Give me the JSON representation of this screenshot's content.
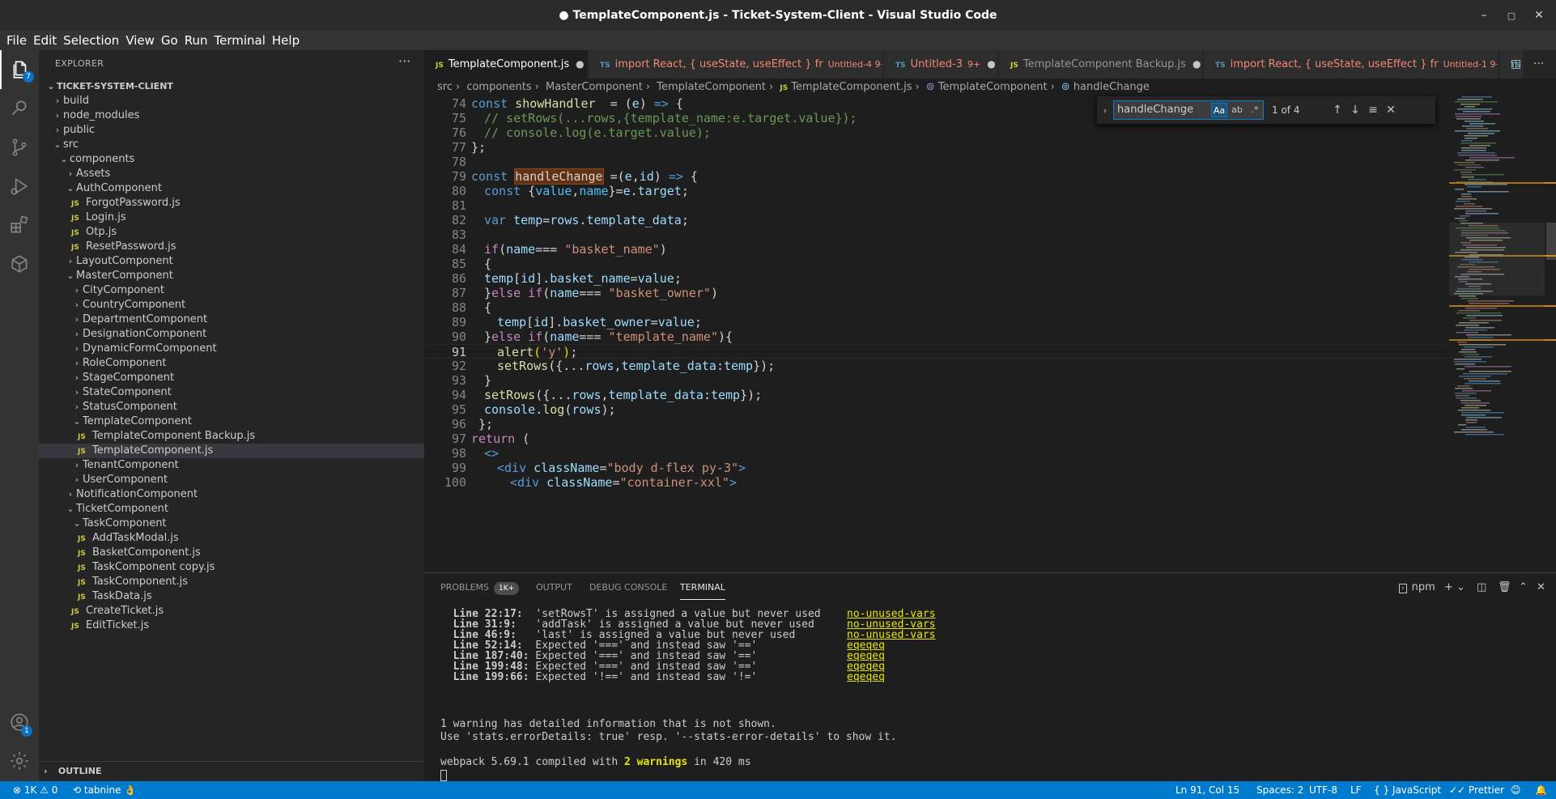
{
  "window": {
    "title": "● TemplateComponent.js - Ticket-System-Client - Visual Studio Code",
    "min_glyph": "–",
    "max_glyph": "▢",
    "close_glyph": "✕"
  },
  "menu": [
    "File",
    "Edit",
    "Selection",
    "View",
    "Go",
    "Run",
    "Terminal",
    "Help"
  ],
  "activity_bar": {
    "explorer_badge": "7",
    "accounts_badge": "1",
    "icons": [
      "files-icon",
      "search-icon",
      "source-control-icon",
      "run-debug-icon",
      "extensions-icon",
      "remote-explorer-icon",
      "accounts-icon",
      "settings-gear-icon"
    ]
  },
  "sidebar": {
    "title": "EXPLORER",
    "more": "···",
    "tree": [
      {
        "label": "TICKET-SYSTEM-CLIENT",
        "depth": 0,
        "kind": "root"
      },
      {
        "label": "build",
        "depth": 1,
        "kind": "folder-closed"
      },
      {
        "label": "node_modules",
        "depth": 1,
        "kind": "folder-closed"
      },
      {
        "label": "public",
        "depth": 1,
        "kind": "folder-closed"
      },
      {
        "label": "src",
        "depth": 1,
        "kind": "folder-open"
      },
      {
        "label": "components",
        "depth": 2,
        "kind": "folder-open"
      },
      {
        "label": "Assets",
        "depth": 3,
        "kind": "folder-closed"
      },
      {
        "label": "AuthComponent",
        "depth": 3,
        "kind": "folder-open"
      },
      {
        "label": "ForgotPassword.js",
        "depth": 4,
        "kind": "file"
      },
      {
        "label": "Login.js",
        "depth": 4,
        "kind": "file"
      },
      {
        "label": "Otp.js",
        "depth": 4,
        "kind": "file"
      },
      {
        "label": "ResetPassword.js",
        "depth": 4,
        "kind": "file"
      },
      {
        "label": "LayoutComponent",
        "depth": 3,
        "kind": "folder-closed"
      },
      {
        "label": "MasterComponent",
        "depth": 3,
        "kind": "folder-open"
      },
      {
        "label": "CityComponent",
        "depth": 4,
        "kind": "folder-closed"
      },
      {
        "label": "CountryComponent",
        "depth": 4,
        "kind": "folder-closed"
      },
      {
        "label": "DepartmentComponent",
        "depth": 4,
        "kind": "folder-closed"
      },
      {
        "label": "DesignationComponent",
        "depth": 4,
        "kind": "folder-closed"
      },
      {
        "label": "DynamicFormComponent",
        "depth": 4,
        "kind": "folder-closed"
      },
      {
        "label": "RoleComponent",
        "depth": 4,
        "kind": "folder-closed"
      },
      {
        "label": "StageComponent",
        "depth": 4,
        "kind": "folder-closed"
      },
      {
        "label": "StateComponent",
        "depth": 4,
        "kind": "folder-closed"
      },
      {
        "label": "StatusComponent",
        "depth": 4,
        "kind": "folder-closed"
      },
      {
        "label": "TemplateComponent",
        "depth": 4,
        "kind": "folder-open"
      },
      {
        "label": "TemplateComponent Backup.js",
        "depth": 5,
        "kind": "file"
      },
      {
        "label": "TemplateComponent.js",
        "depth": 5,
        "kind": "file",
        "selected": true
      },
      {
        "label": "TenantComponent",
        "depth": 4,
        "kind": "folder-closed"
      },
      {
        "label": "UserComponent",
        "depth": 4,
        "kind": "folder-closed"
      },
      {
        "label": "NotificationComponent",
        "depth": 3,
        "kind": "folder-closed"
      },
      {
        "label": "TicketComponent",
        "depth": 3,
        "kind": "folder-open"
      },
      {
        "label": "TaskComponent",
        "depth": 4,
        "kind": "folder-open"
      },
      {
        "label": "AddTaskModal.js",
        "depth": 5,
        "kind": "file"
      },
      {
        "label": "BasketComponent.js",
        "depth": 5,
        "kind": "file"
      },
      {
        "label": "TaskComponent copy.js",
        "depth": 5,
        "kind": "file"
      },
      {
        "label": "TaskComponent.js",
        "depth": 5,
        "kind": "file"
      },
      {
        "label": "TaskData.js",
        "depth": 5,
        "kind": "file"
      },
      {
        "label": "CreateTicket.js",
        "depth": 4,
        "kind": "file"
      },
      {
        "label": "EditTicket.js",
        "depth": 4,
        "kind": "file"
      }
    ],
    "outline_label": "OUTLINE"
  },
  "tabs": [
    {
      "icon": "JS",
      "label": "TemplateComponent.js",
      "active": true,
      "modified": true,
      "error": false,
      "sub": ""
    },
    {
      "icon": "TS",
      "label": "import React, { useState, useEffect } fr",
      "active": false,
      "modified": true,
      "error": true,
      "sub": "Untitled-4  9+"
    },
    {
      "icon": "TS",
      "label": "Untitled-3",
      "active": false,
      "modified": true,
      "error": true,
      "sub": "9+"
    },
    {
      "icon": "JS",
      "label": "TemplateComponent Backup.js",
      "active": false,
      "modified": true,
      "error": false,
      "sub": ""
    },
    {
      "icon": "TS",
      "label": "import React, { useState, useEffect } fr",
      "active": false,
      "modified": true,
      "error": true,
      "sub": "Untitled-1  9+"
    },
    {
      "icon": "TS",
      "label": "",
      "active": false,
      "modified": false,
      "error": false,
      "sub": ""
    }
  ],
  "breadcrumb": [
    "src",
    "components",
    "MasterComponent",
    "TemplateComponent",
    "TemplateComponent.js",
    "TemplateComponent",
    "handleChange"
  ],
  "editor": {
    "current_line": 91,
    "lines": [
      {
        "n": 74,
        "indent": 0,
        "tokens": [
          [
            "kw",
            "const "
          ],
          [
            "fn",
            "showHandler"
          ],
          [
            "",
            "  = ("
          ],
          [
            "var",
            "e"
          ],
          [
            "",
            ") "
          ],
          [
            "kw",
            "=>"
          ],
          [
            "",
            " {"
          ]
        ]
      },
      {
        "n": 75,
        "indent": 1,
        "tokens": [
          [
            "com",
            "// setRows(...rows,{template_name:e.target.value});"
          ]
        ]
      },
      {
        "n": 76,
        "indent": 1,
        "tokens": [
          [
            "com",
            "// console.log(e.target.value);"
          ]
        ]
      },
      {
        "n": 77,
        "indent": 0,
        "tokens": [
          [
            "",
            "};"
          ]
        ]
      },
      {
        "n": 78,
        "indent": 0,
        "tokens": []
      },
      {
        "n": 79,
        "indent": 0,
        "tokens": [
          [
            "kw",
            "const "
          ],
          [
            "hl",
            "handleChange"
          ],
          [
            "",
            " =("
          ],
          [
            "var",
            "e"
          ],
          [
            "",
            ","
          ],
          [
            "var",
            "id"
          ],
          [
            "",
            ") "
          ],
          [
            "kw",
            "=>"
          ],
          [
            "",
            " {"
          ]
        ]
      },
      {
        "n": 80,
        "indent": 1,
        "tokens": [
          [
            "kw",
            "const "
          ],
          [
            "",
            "{"
          ],
          [
            "cst",
            "value"
          ],
          [
            "",
            ","
          ],
          [
            "cst",
            "name"
          ],
          [
            "",
            "}="
          ],
          [
            "var",
            "e"
          ],
          [
            "",
            "."
          ],
          [
            "var",
            "target"
          ],
          [
            "",
            ";"
          ]
        ]
      },
      {
        "n": 81,
        "indent": 0,
        "tokens": []
      },
      {
        "n": 82,
        "indent": 1,
        "tokens": [
          [
            "kw",
            "var "
          ],
          [
            "var",
            "temp"
          ],
          [
            "",
            "="
          ],
          [
            "var",
            "rows"
          ],
          [
            "",
            "."
          ],
          [
            "var",
            "template_data"
          ],
          [
            "",
            ";"
          ]
        ]
      },
      {
        "n": 83,
        "indent": 0,
        "tokens": []
      },
      {
        "n": 84,
        "indent": 1,
        "tokens": [
          [
            "ctl",
            "if"
          ],
          [
            "",
            "("
          ],
          [
            "var",
            "name"
          ],
          [
            "",
            "=== "
          ],
          [
            "str",
            "\"basket_name\""
          ],
          [
            "",
            ")"
          ]
        ]
      },
      {
        "n": 85,
        "indent": 1,
        "tokens": [
          [
            "",
            "{"
          ]
        ]
      },
      {
        "n": 86,
        "indent": 1,
        "tokens": [
          [
            "var",
            "temp"
          ],
          [
            "",
            "["
          ],
          [
            "var",
            "id"
          ],
          [
            "",
            "]."
          ],
          [
            "var",
            "basket_name"
          ],
          [
            "",
            "="
          ],
          [
            "var",
            "value"
          ],
          [
            "",
            ";"
          ]
        ]
      },
      {
        "n": 87,
        "indent": 1,
        "tokens": [
          [
            "",
            "}"
          ],
          [
            "ctl",
            "else if"
          ],
          [
            "",
            "("
          ],
          [
            "var",
            "name"
          ],
          [
            "",
            "=== "
          ],
          [
            "str",
            "\"basket_owner\""
          ],
          [
            "",
            ")"
          ]
        ]
      },
      {
        "n": 88,
        "indent": 1,
        "tokens": [
          [
            "",
            "{"
          ]
        ]
      },
      {
        "n": 89,
        "indent": 2,
        "tokens": [
          [
            "var",
            "temp"
          ],
          [
            "",
            "["
          ],
          [
            "var",
            "id"
          ],
          [
            "",
            "]."
          ],
          [
            "var",
            "basket_owner"
          ],
          [
            "",
            "="
          ],
          [
            "var",
            "value"
          ],
          [
            "",
            ";"
          ]
        ]
      },
      {
        "n": 90,
        "indent": 1,
        "tokens": [
          [
            "",
            "}"
          ],
          [
            "ctl",
            "else if"
          ],
          [
            "",
            "("
          ],
          [
            "var",
            "name"
          ],
          [
            "",
            "=== "
          ],
          [
            "str",
            "\"template_name\""
          ],
          [
            "",
            "){"
          ]
        ]
      },
      {
        "n": 91,
        "indent": 2,
        "tokens": [
          [
            "fn",
            "alert"
          ],
          [
            "br1",
            "("
          ],
          [
            "str",
            "'y'"
          ],
          [
            "br1",
            ")"
          ],
          [
            "",
            ";"
          ]
        ]
      },
      {
        "n": 92,
        "indent": 2,
        "tokens": [
          [
            "fn",
            "setRows"
          ],
          [
            "",
            "({..."
          ],
          [
            "var",
            "rows"
          ],
          [
            "",
            ","
          ],
          [
            "var",
            "template_data"
          ],
          [
            "",
            ":"
          ],
          [
            "var",
            "temp"
          ],
          [
            "",
            "});"
          ]
        ]
      },
      {
        "n": 93,
        "indent": 1,
        "tokens": [
          [
            "",
            "}"
          ]
        ]
      },
      {
        "n": 94,
        "indent": 1,
        "tokens": [
          [
            "fn",
            "setRows"
          ],
          [
            "",
            "({..."
          ],
          [
            "var",
            "rows"
          ],
          [
            "",
            ","
          ],
          [
            "var",
            "template_data"
          ],
          [
            "",
            ":"
          ],
          [
            "var",
            "temp"
          ],
          [
            "",
            "});"
          ]
        ]
      },
      {
        "n": 95,
        "indent": 1,
        "tokens": [
          [
            "var",
            "console"
          ],
          [
            "",
            "."
          ],
          [
            "fn",
            "log"
          ],
          [
            "",
            "("
          ],
          [
            "var",
            "rows"
          ],
          [
            "",
            ");"
          ]
        ]
      },
      {
        "n": 96,
        "indent": 0,
        "tokens": [
          [
            "",
            " };"
          ]
        ]
      },
      {
        "n": 97,
        "indent": 0,
        "tokens": [
          [
            "ctl",
            "return"
          ],
          [
            "",
            " ("
          ]
        ]
      },
      {
        "n": 98,
        "indent": 1,
        "tokens": [
          [
            "tag",
            "<>"
          ]
        ]
      },
      {
        "n": 99,
        "indent": 2,
        "tokens": [
          [
            "tag",
            "<div "
          ],
          [
            "attr",
            "className"
          ],
          [
            "",
            "="
          ],
          [
            "str",
            "\"body d-flex py-3\""
          ],
          [
            "tag",
            ">"
          ]
        ]
      },
      {
        "n": 100,
        "indent": 3,
        "tokens": [
          [
            "tag",
            "<div "
          ],
          [
            "attr",
            "className"
          ],
          [
            "",
            "="
          ],
          [
            "str",
            "\"container-xxl\""
          ],
          [
            "tag",
            ">"
          ]
        ]
      }
    ]
  },
  "find": {
    "query": "handleChange",
    "opt_case": "Aa",
    "opt_word": "ab",
    "opt_regex": ".*",
    "count": "1 of 4",
    "prev": "↑",
    "next": "↓",
    "in_selection": "≡",
    "close": "✕"
  },
  "panel": {
    "tabs": [
      {
        "label": "PROBLEMS",
        "badge": "1K+"
      },
      {
        "label": "OUTPUT",
        "badge": ""
      },
      {
        "label": "DEBUG CONSOLE",
        "badge": ""
      },
      {
        "label": "TERMINAL",
        "badge": "",
        "active": true
      }
    ],
    "terminal_name": "npm",
    "terminal_lines": [
      {
        "loc": "  Line 22:17:",
        "msg": "  'setRowsT' is assigned a value but never used",
        "rule": "no-unused-vars"
      },
      {
        "loc": "  Line 31:9:",
        "msg": "   'addTask' is assigned a value but never used",
        "rule": "no-unused-vars"
      },
      {
        "loc": "  Line 46:9:",
        "msg": "   'last' is assigned a value but never used",
        "rule": "no-unused-vars"
      },
      {
        "loc": "  Line 52:14:",
        "msg": "  Expected '===' and instead saw '=='",
        "rule": "eqeqeq"
      },
      {
        "loc": "  Line 187:40:",
        "msg": " Expected '===' and instead saw '=='",
        "rule": "eqeqeq"
      },
      {
        "loc": "  Line 199:48:",
        "msg": " Expected '===' and instead saw '=='",
        "rule": "eqeqeq"
      },
      {
        "loc": "  Line 199:66:",
        "msg": " Expected '!==' and instead saw '!='",
        "rule": "eqeqeq"
      }
    ],
    "info_1": "1 warning has detailed information that is not shown.",
    "info_2": "Use 'stats.errorDetails: true' resp. '--stats-error-details' to show it.",
    "compiled_pre": "webpack 5.69.1 compiled with ",
    "compiled_warn": "2 warnings",
    "compiled_post": " in 420 ms"
  },
  "status": {
    "problems": "⊗ 1K ⚠ 0",
    "tabnine": "⟲ tabnine 👌",
    "position": "Ln 91, Col 15",
    "spaces": "Spaces: 2",
    "encoding": "UTF-8",
    "eol": "LF",
    "language": "{ } JavaScript",
    "prettier": "✓✓ Prettier"
  }
}
